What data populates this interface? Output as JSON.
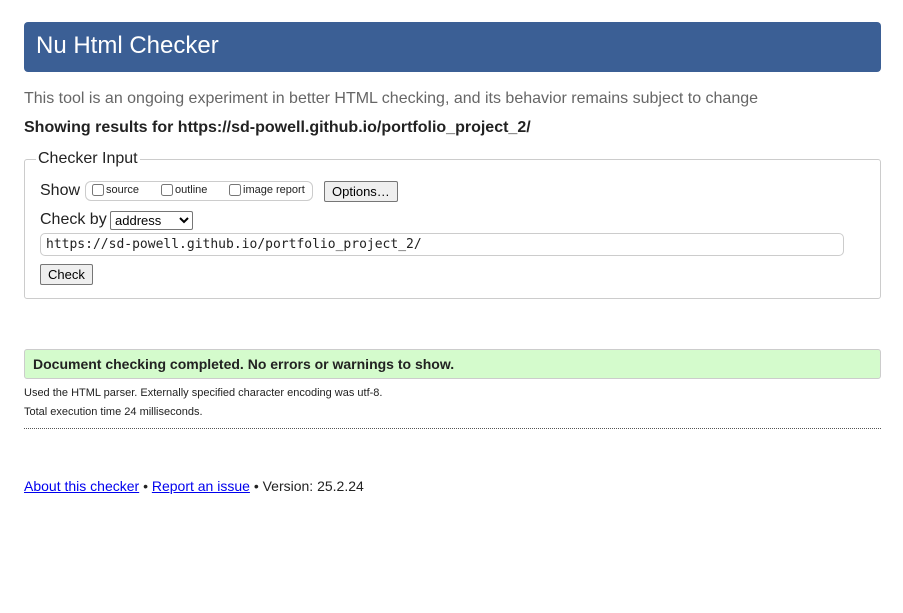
{
  "header": {
    "title": "Nu Html Checker"
  },
  "intro": "This tool is an ongoing experiment in better HTML checking, and its behavior remains subject to change",
  "showing": "Showing results for https://sd-powell.github.io/portfolio_project_2/",
  "checker_input": {
    "legend": "Checker Input",
    "show_label": "Show",
    "options": [
      {
        "label": "source",
        "checked": false
      },
      {
        "label": "outline",
        "checked": false
      },
      {
        "label": "image report",
        "checked": false
      }
    ],
    "options_button": "Options…",
    "check_by_label": "Check by",
    "check_by_value": "address",
    "url_value": "https://sd-powell.github.io/portfolio_project_2/",
    "check_button": "Check"
  },
  "result": {
    "message": "Document checking completed. No errors or warnings to show.",
    "color": "#d4fbcc",
    "parser_info": "Used the HTML parser. Externally specified character encoding was utf-8.",
    "execution_time": "Total execution time 24 milliseconds."
  },
  "footer": {
    "about": "About this checker",
    "sep": "•",
    "report": "Report an issue",
    "version": "Version: 25.2.24"
  }
}
